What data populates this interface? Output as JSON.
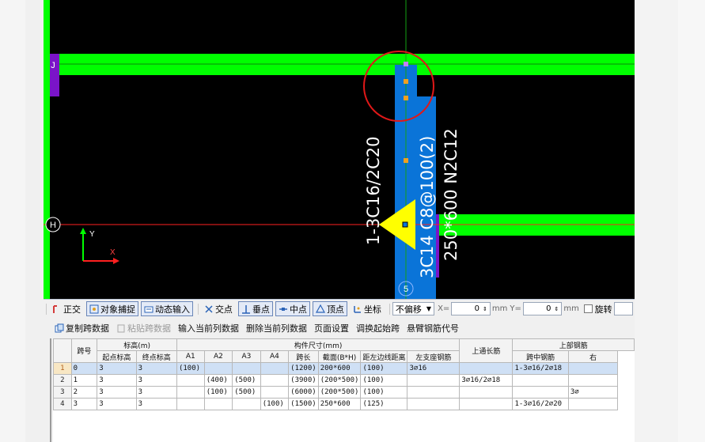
{
  "snapbar": {
    "ortho": "正交",
    "object_snap": "对象捕捉",
    "dynamic_input": "动态输入",
    "intersection": "交点",
    "perpendicular": "垂点",
    "midpoint": "中点",
    "vertex": "顶点",
    "coordinate": "坐标",
    "offset_mode": "不偏移",
    "x_label": "X=",
    "x_value": "0",
    "x_unit": "mm",
    "y_label": "Y=",
    "y_value": "0",
    "y_unit": "mm",
    "rotate": "旋转"
  },
  "toolbar2": {
    "copy_span": "复制跨数据",
    "paste_span": "粘贴跨数据",
    "input_current_col": "输入当前列数据",
    "delete_current_col": "删除当前列数据",
    "page_setup": "页面设置",
    "adjust_start_span": "调换起始跨",
    "cantilever_code": "悬臂钢筋代号"
  },
  "grid": {
    "headers": {
      "span_no": "跨号",
      "elevation": "标高(m)",
      "start_elev": "起点标高",
      "end_elev": "终点标高",
      "member_size": "构件尺寸(mm)",
      "a1": "A1",
      "a2": "A2",
      "a3": "A3",
      "a4": "A4",
      "span_len": "跨长",
      "section": "截面(B*H)",
      "dist_left": "距左边线距离",
      "top_through": "上通长筋",
      "top_rebar": "上部钢筋",
      "left_support": "左支座钢筋",
      "mid_span": "跨中钢筋",
      "right_support": "右"
    },
    "rows": [
      {
        "n": "1",
        "span": "0",
        "start": "3",
        "end": "3",
        "a1": "(100)",
        "a2": "",
        "a3": "",
        "a4": "",
        "len": "(1200)",
        "sec": "200*600",
        "dist": "(100)",
        "through": "3⌀16",
        "left": "",
        "mid": "1-3⌀16/2⌀18",
        "right": ""
      },
      {
        "n": "2",
        "span": "1",
        "start": "3",
        "end": "3",
        "a1": "",
        "a2": "(400)",
        "a3": "(500)",
        "a4": "",
        "len": "(3900)",
        "sec": "(200*500)",
        "dist": "(100)",
        "through": "",
        "left": "3⌀16/2⌀18",
        "mid": "",
        "right": ""
      },
      {
        "n": "3",
        "span": "2",
        "start": "3",
        "end": "3",
        "a1": "",
        "a2": "(100)",
        "a3": "(500)",
        "a4": "",
        "len": "(6000)",
        "sec": "(200*500)",
        "dist": "(100)",
        "through": "",
        "left": "",
        "mid": "",
        "right": "3⌀"
      },
      {
        "n": "4",
        "span": "3",
        "start": "3",
        "end": "3",
        "a1": "",
        "a2": "",
        "a3": "",
        "a4": "(100)",
        "len": "(1500)",
        "sec": "250*600",
        "dist": "(125)",
        "through": "",
        "left": "",
        "mid": "1-3⌀16/2⌀20",
        "right": ""
      }
    ]
  },
  "canvas": {
    "axis_j": "J",
    "axis_h": "H",
    "axis_5": "5",
    "ucs_y": "Y",
    "ucs_x": "X",
    "label_left": "1-3C16/2C20",
    "label_mid": "3C14 C8@100(2)",
    "label_right": "250*600 N2C12",
    "colors": {
      "beam": "#00ff00",
      "column": "#0a74d8",
      "highlight": "#ff0000",
      "grip": "#f0a020",
      "marker": "#ffff00"
    }
  }
}
